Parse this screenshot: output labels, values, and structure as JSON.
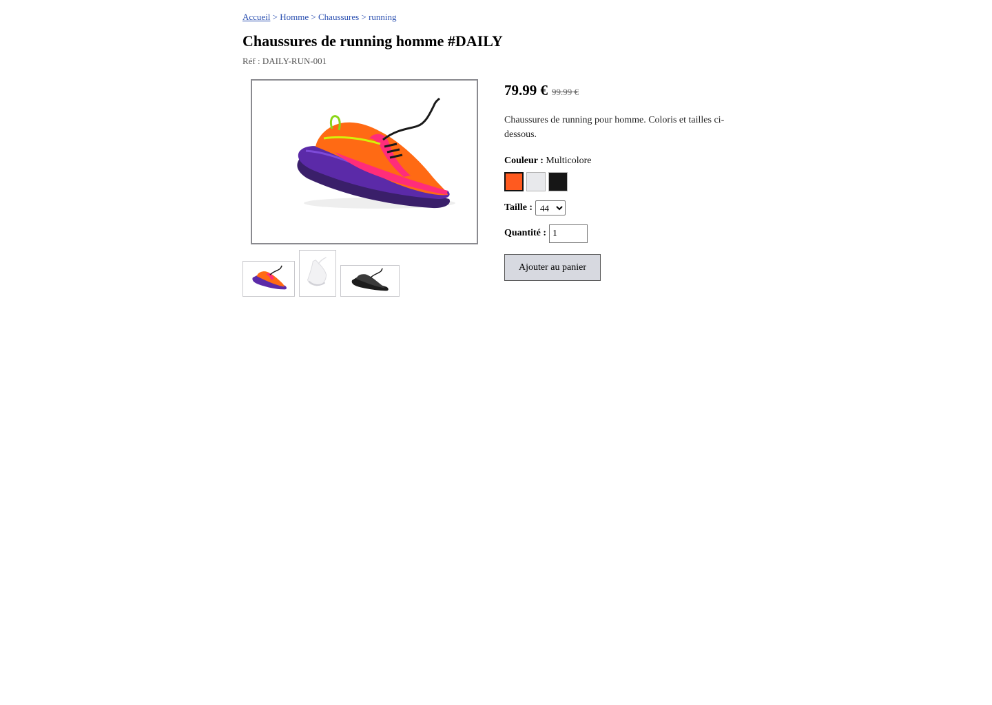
{
  "breadcrumb": {
    "items": [
      "Accueil",
      "Homme",
      "Chaussures",
      "running"
    ],
    "separator": ">"
  },
  "product": {
    "title": "Chaussures de running homme #DAILY",
    "reference": "Réf : DAILY-RUN-001",
    "price_current": "79.99 €",
    "price_old": "99.99 €",
    "description": "Chaussures de running pour homme. Coloris et tailles ci-dessous."
  },
  "color": {
    "label": "Couleur :",
    "value": "Multicolore",
    "swatches": [
      {
        "name": "orange",
        "hex": "#ff5a1f",
        "selected": true
      },
      {
        "name": "light-grey",
        "hex": "#e8e9ec",
        "selected": false
      },
      {
        "name": "black",
        "hex": "#161616",
        "selected": false
      }
    ]
  },
  "size": {
    "label": "Taille :",
    "selected": "44"
  },
  "quantity": {
    "label": "Quantité :",
    "value": "1"
  },
  "actions": {
    "add_to_cart": "Ajouter au panier"
  },
  "images": {
    "main_icon": "shoe-photo-multicolor",
    "thumbnails": [
      "shoe-thumb-multicolor",
      "shoe-thumb-white",
      "shoe-thumb-black"
    ]
  },
  "colors": {
    "link": "#2a4fb0",
    "button_bg": "#d7d9e0"
  }
}
